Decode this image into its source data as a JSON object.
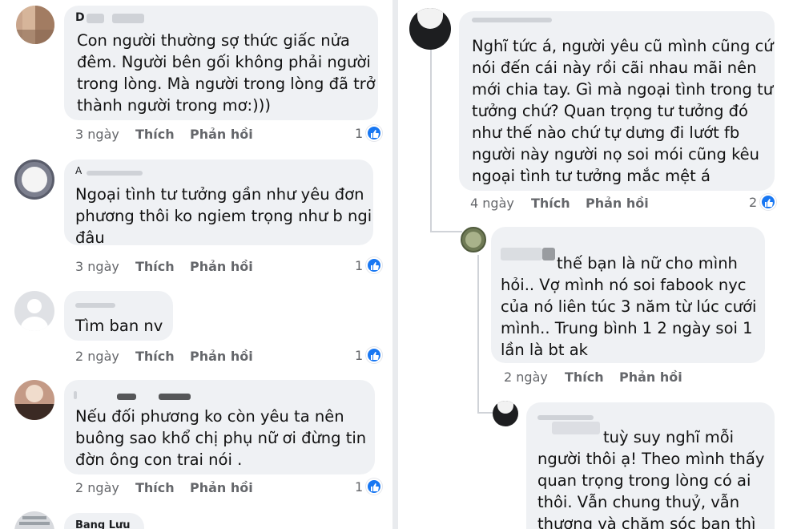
{
  "colors": {
    "bubble": "#eff1f4",
    "meta": "#65676b",
    "like_badge": "#1877f2"
  },
  "left_comments": [
    {
      "author": "D",
      "lines": [
        "Con người thường sợ thức giấc nửa",
        "đêm. Người bên gối không phải người",
        "trong lòng. Mà người trong lòng đã trở",
        "thành người trong mơ:)))"
      ],
      "time": "3 ngày",
      "like": "Thích",
      "reply": "Phản hồi",
      "reactions": "1"
    },
    {
      "author": "A",
      "lines": [
        "Ngoại tình tư tưởng gần như yêu đơn",
        "phương thôi ko ngiem trọng như b ngi",
        "đâu"
      ],
      "time": "3 ngày",
      "like": "Thích",
      "reply": "Phản hồi",
      "reactions": "1"
    },
    {
      "author": "",
      "lines": [
        "Tìm ban nv"
      ],
      "time": "2 ngày",
      "like": "Thích",
      "reply": "Phản hồi",
      "reactions": "1"
    },
    {
      "author": "",
      "lines": [
        "Nếu đối phương ko còn yêu ta nên",
        "buông  sao khổ chị phụ nữ ơi đừng tin",
        "đờn ông con trai nói ."
      ],
      "time": "2 ngày",
      "like": "Thích",
      "reply": "Phản hồi",
      "reactions": "1"
    },
    {
      "author": "Bang Lưu",
      "lines": [],
      "time": "",
      "like": "",
      "reply": "",
      "reactions": ""
    }
  ],
  "right_comments": [
    {
      "author": "",
      "lines": [
        "Nghĩ tức á, người yêu cũ mình cũng cứ",
        "nói đến cái này rồi cãi nhau mãi nên",
        "mới chia tay. Gì mà ngoại tình trong tư",
        "tưởng chứ? Quan trọng tư tưởng đó",
        "như thế nào chứ tự dưng đi lướt fb",
        "người này người nọ soi mói cũng kêu",
        "ngoại tình tư tưởng mắc mệt á"
      ],
      "time": "4 ngày",
      "like": "Thích",
      "reply": "Phản hồi",
      "reactions": "2"
    },
    {
      "author": "",
      "lines": [
        "thế bạn là nữ cho mình",
        "hỏi.. Vợ mình nó soi fabook nyc",
        "của nó liên túc 3 năm từ lúc cưới",
        "mình.. Trung bình 1 2 ngày soi 1",
        "lần là bt ak"
      ],
      "time": "2 ngày",
      "like": "Thích",
      "reply": "Phản hồi",
      "reactions": ""
    },
    {
      "author": "",
      "lines": [
        "tuỳ suy nghĩ mỗi",
        "người thôi ạ! Theo mình thấy",
        "quan trọng trong lòng có ai",
        "thôi. Vẫn chung thuỷ, vẫn",
        "thương và chăm sóc ban thì"
      ],
      "time": "",
      "like": "",
      "reply": "",
      "reactions": ""
    }
  ]
}
